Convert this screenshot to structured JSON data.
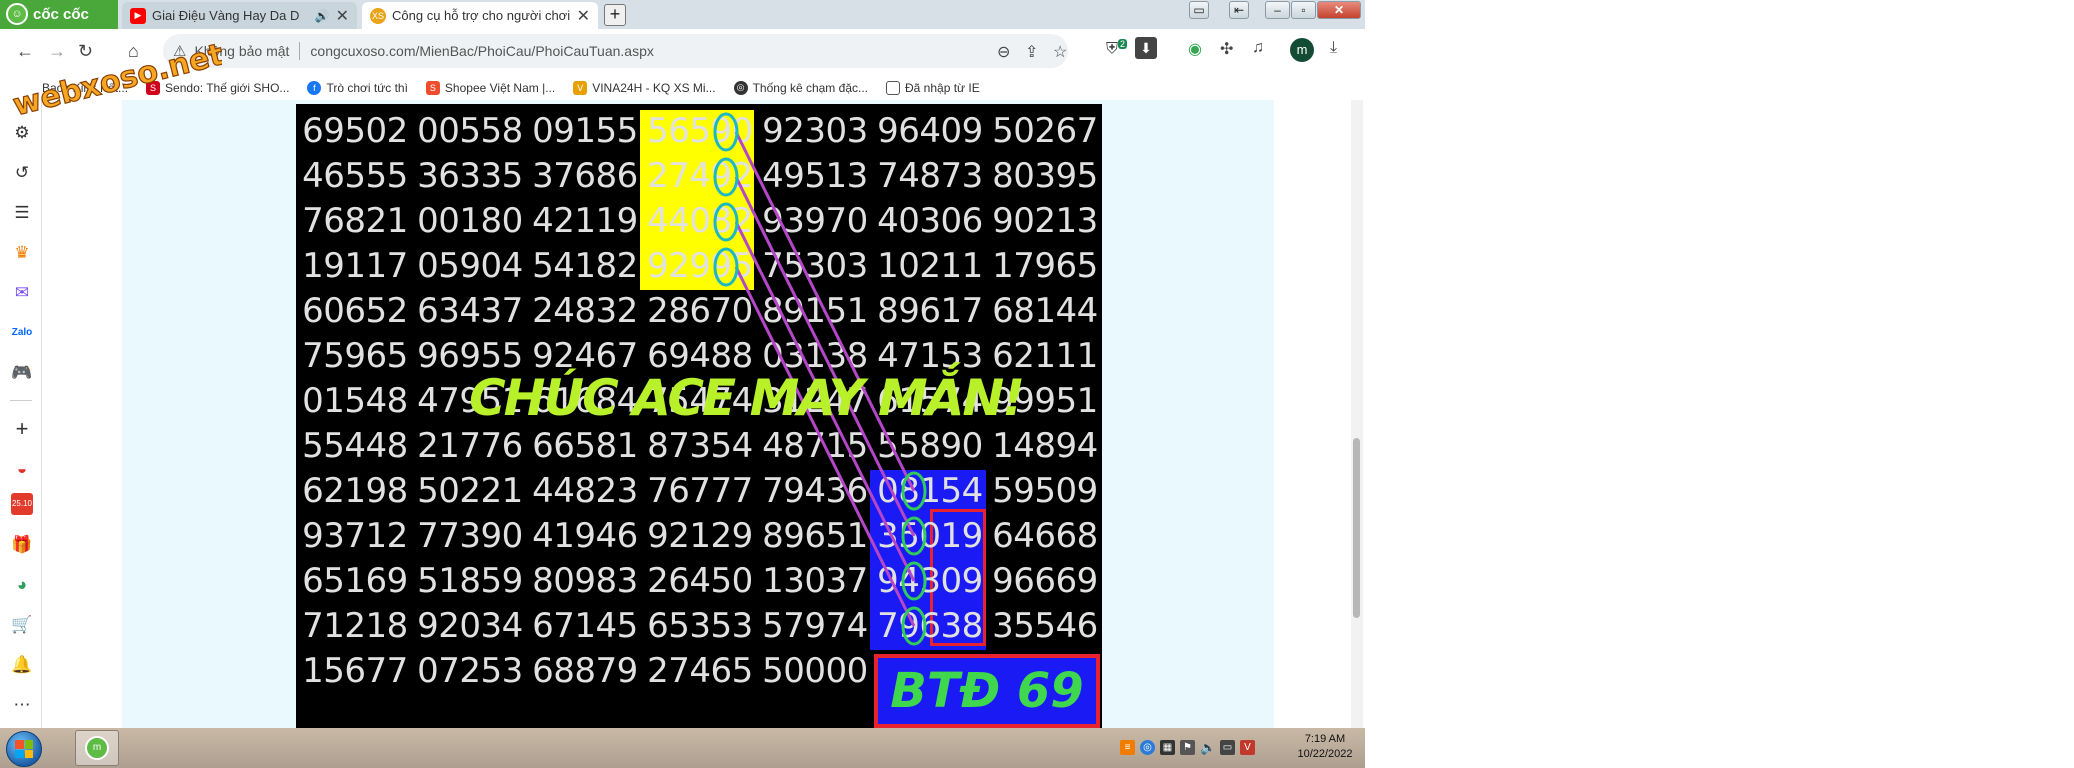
{
  "browser": {
    "brand": "cốc cốc",
    "tabs": [
      {
        "label": "Giai Điệu Vàng Hay Da D",
        "audio_icon": "speaker-icon",
        "favicon": "youtube-icon"
      },
      {
        "label": "Công cụ hỗ trợ cho người chơi",
        "favicon": "xs-icon"
      }
    ],
    "new_tab_label": "+",
    "address": {
      "security_label": "Không bảo mật",
      "url": "congcuxoso.com/MienBac/PhoiCau/PhoiCauTuan.aspx"
    },
    "extension_badge": "2",
    "profile_initial": "m",
    "bookmarks": [
      {
        "label": "Bạch Kim: Kết...",
        "icon_color": "#c0392b"
      },
      {
        "label": "Sendo: Thế giới SHO...",
        "icon_color": "#d0021b"
      },
      {
        "label": "Trò chơi tức thì",
        "icon_color": "#1877f2"
      },
      {
        "label": "Shopee Việt Nam |...",
        "icon_color": "#ee4d2d"
      },
      {
        "label": "VINA24H - KQ XS Mi...",
        "icon_color": "#e6a100"
      },
      {
        "label": "Thống kê chạm đặc...",
        "icon_color": "#333333"
      },
      {
        "label": "Đã nhập từ IE",
        "icon_color": "#555555"
      }
    ],
    "side_badge": "25.10"
  },
  "watermark": "webxoso.net",
  "board": {
    "rows": [
      [
        "69502",
        "00558",
        "09155",
        "56590",
        "92303",
        "96409",
        "50267"
      ],
      [
        "46555",
        "36335",
        "37686",
        "27492",
        "49513",
        "74873",
        "80395"
      ],
      [
        "76821",
        "00180",
        "42119",
        "44082",
        "93970",
        "40306",
        "90213"
      ],
      [
        "19117",
        "05904",
        "54182",
        "92995",
        "75303",
        "10211",
        "17965"
      ],
      [
        "60652",
        "63437",
        "24832",
        "28670",
        "89151",
        "89617",
        "68144"
      ],
      [
        "75965",
        "96955",
        "92467",
        "69488",
        "03138",
        "47153",
        "62111"
      ],
      [
        "01548",
        "47951",
        "61684",
        "75474",
        "31247",
        "61574",
        "99951"
      ],
      [
        "55448",
        "21776",
        "66581",
        "87354",
        "48715",
        "55890",
        "14894"
      ],
      [
        "62198",
        "50221",
        "44823",
        "76777",
        "79436",
        "08154",
        "59509"
      ],
      [
        "93712",
        "77390",
        "41946",
        "92129",
        "89651",
        "35019",
        "64668"
      ],
      [
        "65169",
        "51859",
        "80983",
        "26450",
        "13037",
        "94309",
        "96669"
      ],
      [
        "71218",
        "92034",
        "67145",
        "65353",
        "57974",
        "79638",
        "35546"
      ],
      [
        "15677",
        "07253",
        "68879",
        "27465",
        "50000",
        "",
        ""
      ]
    ],
    "overlay_text": "CHÚC ACE MAY MẮN!",
    "prediction": "BTĐ 69"
  },
  "colors": {
    "board_bg": "#000000",
    "yellow_highlight": "#ffff00",
    "blue_highlight": "#1a1af5",
    "red_box": "#e8232f",
    "prediction_text": "#3ed74e",
    "overlay_text": "#b8f02a",
    "arrow_line": "#b446c8",
    "circle": "#1bb8c4"
  },
  "taskbar": {
    "time": "7:19 AM",
    "date": "10/22/2022"
  }
}
